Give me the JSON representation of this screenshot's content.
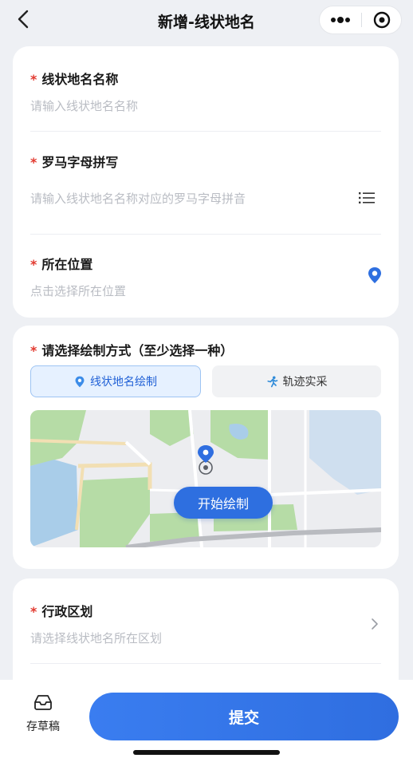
{
  "header": {
    "title": "新增-线状地名",
    "back_icon": "chevron-left-icon",
    "more_icon": "more-dots-icon",
    "target_icon": "target-icon"
  },
  "form": {
    "name": {
      "required_mark": "*",
      "label": "线状地名名称",
      "placeholder": "请输入线状地名名称"
    },
    "roman": {
      "required_mark": "*",
      "label": "罗马字母拼写",
      "placeholder": "请输入线状地名名称对应的罗马字母拼音",
      "icon": "list-icon"
    },
    "location": {
      "required_mark": "*",
      "label": "所在位置",
      "placeholder": "点击选择所在位置",
      "icon": "location-pin-icon"
    },
    "draw_method": {
      "required_mark": "*",
      "label": "请选择绘制方式（至少选择一种）",
      "options": [
        {
          "label": "线状地名绘制",
          "icon": "location-pin-icon",
          "selected": true
        },
        {
          "label": "轨迹实采",
          "icon": "runner-icon",
          "selected": false
        }
      ],
      "start_button": "开始绘制"
    },
    "district": {
      "required_mark": "*",
      "label": "行政区划",
      "placeholder": "请选择线状地名所在区划",
      "icon": "chevron-right-icon"
    }
  },
  "footer": {
    "draft_label": "存草稿",
    "draft_icon": "inbox-tray-icon",
    "submit_label": "提交"
  },
  "colors": {
    "primary": "#2e6fe0",
    "required": "#e2392f",
    "placeholder": "#b9bcc3",
    "background": "#eef0f4"
  }
}
